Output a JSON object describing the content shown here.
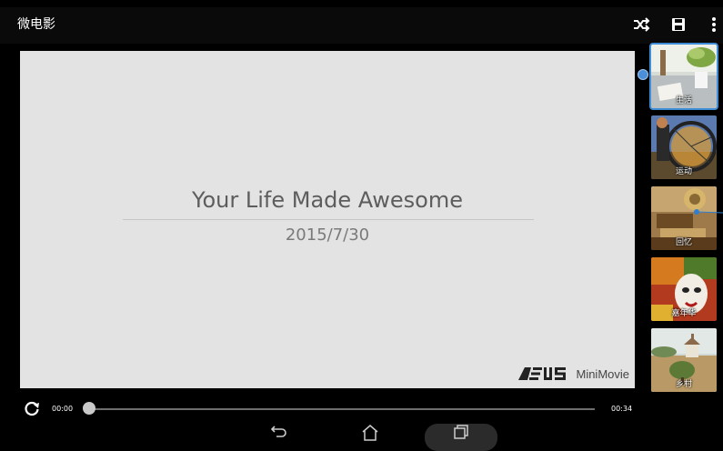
{
  "app": {
    "title": "微电影"
  },
  "toolbar": {
    "icons": [
      "shuffle-icon",
      "save-icon",
      "more-vert-icon"
    ]
  },
  "preview": {
    "title": "Your Life Made Awesome",
    "date": "2015/7/30",
    "watermark_brand": "ASUS",
    "watermark_product": "MiniMovie"
  },
  "themes": {
    "items": [
      {
        "label": "生活",
        "icon": "life-thumbnail",
        "selected": true
      },
      {
        "label": "运动",
        "icon": "sport-thumbnail",
        "selected": false
      },
      {
        "label": "回忆",
        "icon": "memory-thumbnail",
        "selected": false
      },
      {
        "label": "嘉年华",
        "icon": "carnival-thumbnail",
        "selected": false
      },
      {
        "label": "乡村",
        "icon": "countryside-thumbnail",
        "selected": false
      }
    ]
  },
  "playback": {
    "current_time": "00:00",
    "total_time": "00:34",
    "progress": 0
  },
  "navigation": {
    "icons": [
      "back-icon",
      "home-icon",
      "recents-icon"
    ]
  },
  "colors": {
    "accent": "#3e8ed7",
    "preview_bg": "#e3e3e3",
    "text_dark": "#5d5d5d"
  }
}
